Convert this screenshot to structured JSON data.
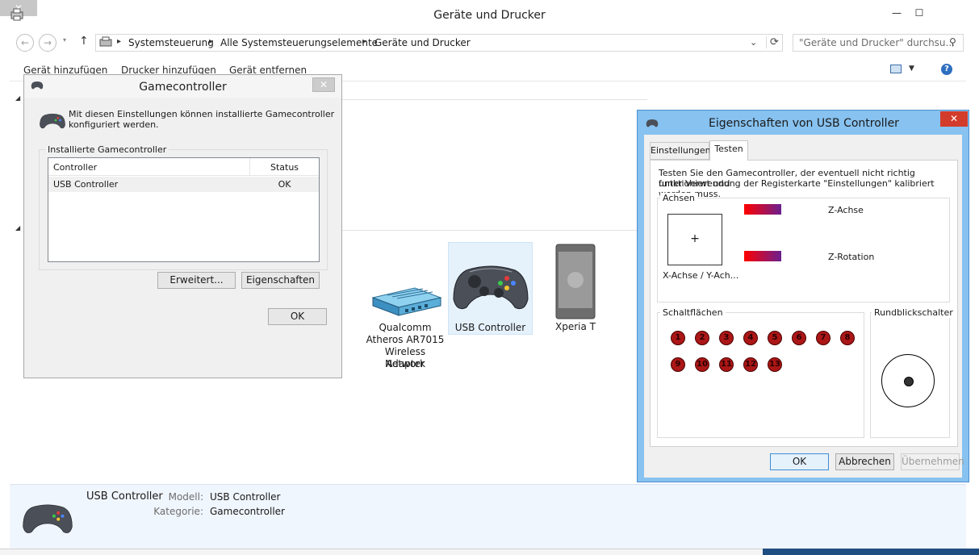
{
  "window": {
    "title": "Geräte und Drucker",
    "minimize": "—",
    "maximize": "☐",
    "close": "✕"
  },
  "address": {
    "breadcrumb": [
      "Systemsteuerung",
      "Alle Systemsteuerungselemente",
      "Geräte und Drucker"
    ],
    "separator": "▸",
    "search_placeholder": "\"Geräte und Drucker\" durchsu..."
  },
  "toolbar": {
    "items": [
      "Gerät hinzufügen",
      "Drucker hinzufügen",
      "Gerät entfernen"
    ]
  },
  "devices": {
    "router_label_lines": [
      "Qualcomm",
      "Atheros AR7015",
      "Wireless Network",
      "Adapter"
    ],
    "controller_label": "USB Controller",
    "phone_label": "Xperia T"
  },
  "details": {
    "name": "USB Controller",
    "model_label": "Modell:",
    "model_value": "USB Controller",
    "category_label": "Kategorie:",
    "category_value": "Gamecontroller"
  },
  "gamecontroller_dialog": {
    "title": "Gamecontroller",
    "description_line1": "Mit diesen Einstellungen können installierte Gamecontroller",
    "description_line2": "konfiguriert werden.",
    "group_label": "Installierte Gamecontroller",
    "col_controller": "Controller",
    "col_status": "Status",
    "rows": [
      {
        "controller": "USB Controller",
        "status": "OK"
      }
    ],
    "advanced_button": "Erweitert...",
    "properties_button": "Eigenschaften",
    "ok_button": "OK"
  },
  "properties_dialog": {
    "title": "Eigenschaften von USB Controller",
    "tabs": [
      "Einstellungen",
      "Testen"
    ],
    "active_tab": "Testen",
    "instruction_line1": "Testen Sie den Gamecontroller, der eventuell nicht richtig funktioniert und",
    "instruction_line2": "unter Verwendung der Registerkarte \"Einstellungen\" kalibriert werden muss.",
    "axes_group": "Achsen",
    "xy_label": "X-Achse / Y-Ach...",
    "z_axis_label": "Z-Achse",
    "z_rotation_label": "Z-Rotation",
    "buttons_group": "Schaltflächen",
    "buttons": [
      "1",
      "2",
      "3",
      "4",
      "5",
      "6",
      "7",
      "8",
      "9",
      "10",
      "11",
      "12",
      "13"
    ],
    "hat_group": "Rundblickschalter",
    "ok_button": "OK",
    "cancel_button": "Abbrechen",
    "apply_button": "Übernehmen"
  },
  "colors": {
    "dialog_frame": "#87c2f0",
    "selection": "#e5f1fb",
    "button_red": "#ab1616"
  }
}
